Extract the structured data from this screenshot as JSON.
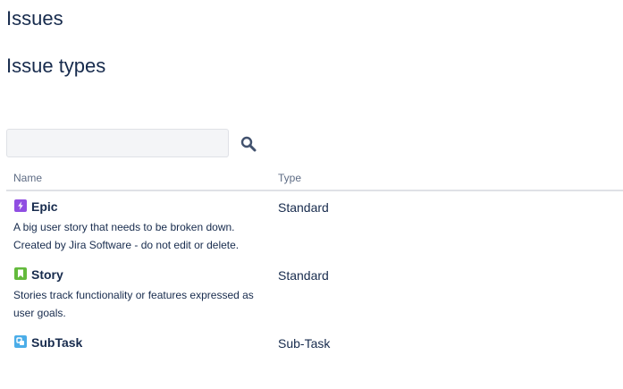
{
  "page": {
    "title": "Issues",
    "section_title": "Issue types"
  },
  "search": {
    "value": "",
    "placeholder": "",
    "icon": "search-icon"
  },
  "table": {
    "headers": {
      "name": "Name",
      "type": "Type"
    },
    "rows": [
      {
        "icon": "epic-icon",
        "icon_color": "#904ee2",
        "name": "Epic",
        "description": "A big user story that needs to be broken down. Created by Jira Software - do not edit or delete.",
        "type": "Standard"
      },
      {
        "icon": "story-icon",
        "icon_color": "#63ba3c",
        "name": "Story",
        "description": "Stories track functionality or features expressed as user goals.",
        "type": "Standard"
      },
      {
        "icon": "subtask-icon",
        "icon_color": "#4bade8",
        "name": "SubTask",
        "description": "",
        "type": "Sub-Task"
      }
    ]
  }
}
